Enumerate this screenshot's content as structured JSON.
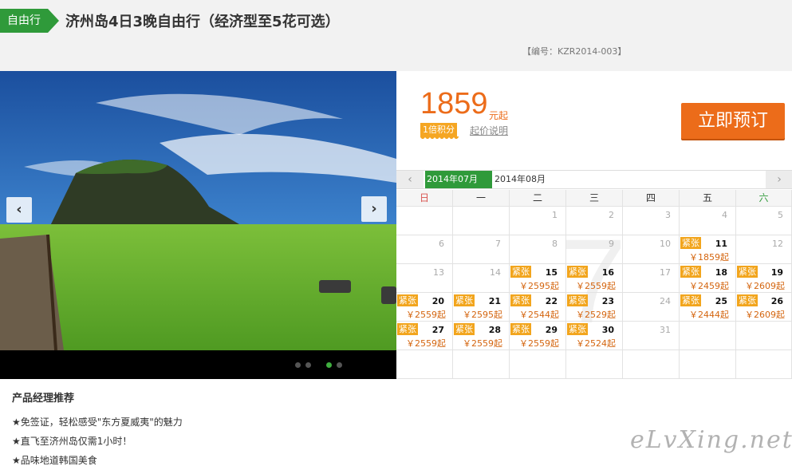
{
  "header": {
    "tag": "自由行",
    "title": "济州岛4日3晚自由行（经济型至5花可选）",
    "code": "【编号：KZR2014-003】"
  },
  "gallery": {
    "prev_icon": "chevron-left-icon",
    "next_icon": "chevron-right-icon",
    "slide_count": 4,
    "active_slide": 3
  },
  "pricing": {
    "price": "1859",
    "unit": "元起",
    "points": "1倍积分",
    "price_note": "起价说明",
    "book_label": "立即预订"
  },
  "calendar": {
    "prev": "‹",
    "next": "›",
    "months": [
      "2014年07月",
      "2014年08月"
    ],
    "active_month": "2014年07月",
    "weekdays": [
      "日",
      "一",
      "二",
      "三",
      "四",
      "五",
      "六"
    ],
    "weekday_colors": {
      "sunday": "#d9534f",
      "saturday": "#2f9a3a"
    },
    "watermark": "7",
    "weeks": [
      [
        null,
        null,
        {
          "d": "1"
        },
        {
          "d": "2"
        },
        {
          "d": "3"
        },
        {
          "d": "4"
        },
        {
          "d": "5"
        }
      ],
      [
        {
          "d": "6"
        },
        {
          "d": "7"
        },
        {
          "d": "8"
        },
        {
          "d": "9"
        },
        {
          "d": "10"
        },
        {
          "d": "11",
          "badge": "紧张",
          "price": "￥1859起"
        },
        {
          "d": "12"
        }
      ],
      [
        {
          "d": "13"
        },
        {
          "d": "14"
        },
        {
          "d": "15",
          "badge": "紧张",
          "price": "￥2595起"
        },
        {
          "d": "16",
          "badge": "紧张",
          "price": "￥2559起"
        },
        {
          "d": "17"
        },
        {
          "d": "18",
          "badge": "紧张",
          "price": "￥2459起"
        },
        {
          "d": "19",
          "badge": "紧张",
          "price": "￥2609起"
        }
      ],
      [
        {
          "d": "20",
          "badge": "紧张",
          "price": "￥2559起"
        },
        {
          "d": "21",
          "badge": "紧张",
          "price": "￥2595起"
        },
        {
          "d": "22",
          "badge": "紧张",
          "price": "￥2544起"
        },
        {
          "d": "23",
          "badge": "紧张",
          "price": "￥2529起"
        },
        {
          "d": "24"
        },
        {
          "d": "25",
          "badge": "紧张",
          "price": "￥2444起"
        },
        {
          "d": "26",
          "badge": "紧张",
          "price": "￥2609起"
        }
      ],
      [
        {
          "d": "27",
          "badge": "紧张",
          "price": "￥2559起"
        },
        {
          "d": "28",
          "badge": "紧张",
          "price": "￥2559起"
        },
        {
          "d": "29",
          "badge": "紧张",
          "price": "￥2559起"
        },
        {
          "d": "30",
          "badge": "紧张",
          "price": "￥2524起"
        },
        {
          "d": "31"
        },
        null,
        null
      ],
      [
        null,
        null,
        null,
        null,
        null,
        null,
        null
      ]
    ]
  },
  "recommend": {
    "title": "产品经理推荐",
    "items": [
      "★免签证，轻松感受\"东方夏威夷\"的魅力",
      "★直飞至济州岛仅需1小时！",
      "★品味地道韩国美食"
    ]
  },
  "brand": "eLvXing.net",
  "colors": {
    "accent_green": "#2f9a3a",
    "accent_orange": "#ec6c1a",
    "badge_orange": "#f2a51d"
  }
}
